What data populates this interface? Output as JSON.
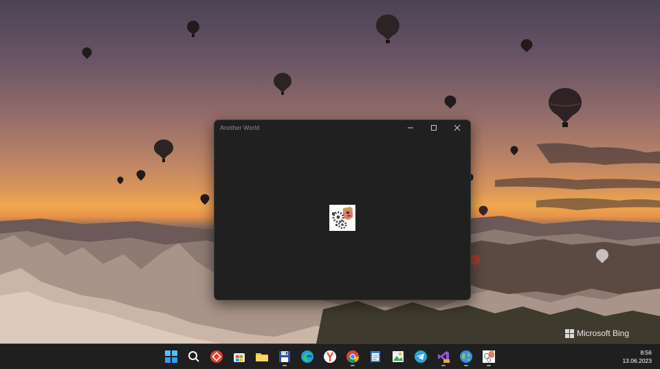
{
  "desktop": {
    "watermark_text": "Microsoft Bing"
  },
  "window": {
    "title": "Another World",
    "controls": [
      "minimize",
      "maximize",
      "close"
    ]
  },
  "taskbar": {
    "apps": [
      {
        "name": "start-icon"
      },
      {
        "name": "search-icon"
      },
      {
        "name": "anydesk-icon"
      },
      {
        "name": "microsoft-store-icon"
      },
      {
        "name": "file-explorer-icon"
      },
      {
        "name": "floppy-disk-app-icon"
      },
      {
        "name": "edge-icon"
      },
      {
        "name": "yandex-browser-icon"
      },
      {
        "name": "chrome-icon"
      },
      {
        "name": "notepad-icon"
      },
      {
        "name": "image-viewer-icon"
      },
      {
        "name": "telegram-icon"
      },
      {
        "name": "visual-studio-preview-icon"
      },
      {
        "name": "globe-app-icon"
      },
      {
        "name": "another-world-icon"
      }
    ],
    "clock": {
      "time": "8:56",
      "date": "13.06.2023"
    }
  },
  "colors": {
    "window_bg": "#202020",
    "taskbar_bg": "#1f1f1f",
    "accent_blue": "#3a8ee6"
  }
}
